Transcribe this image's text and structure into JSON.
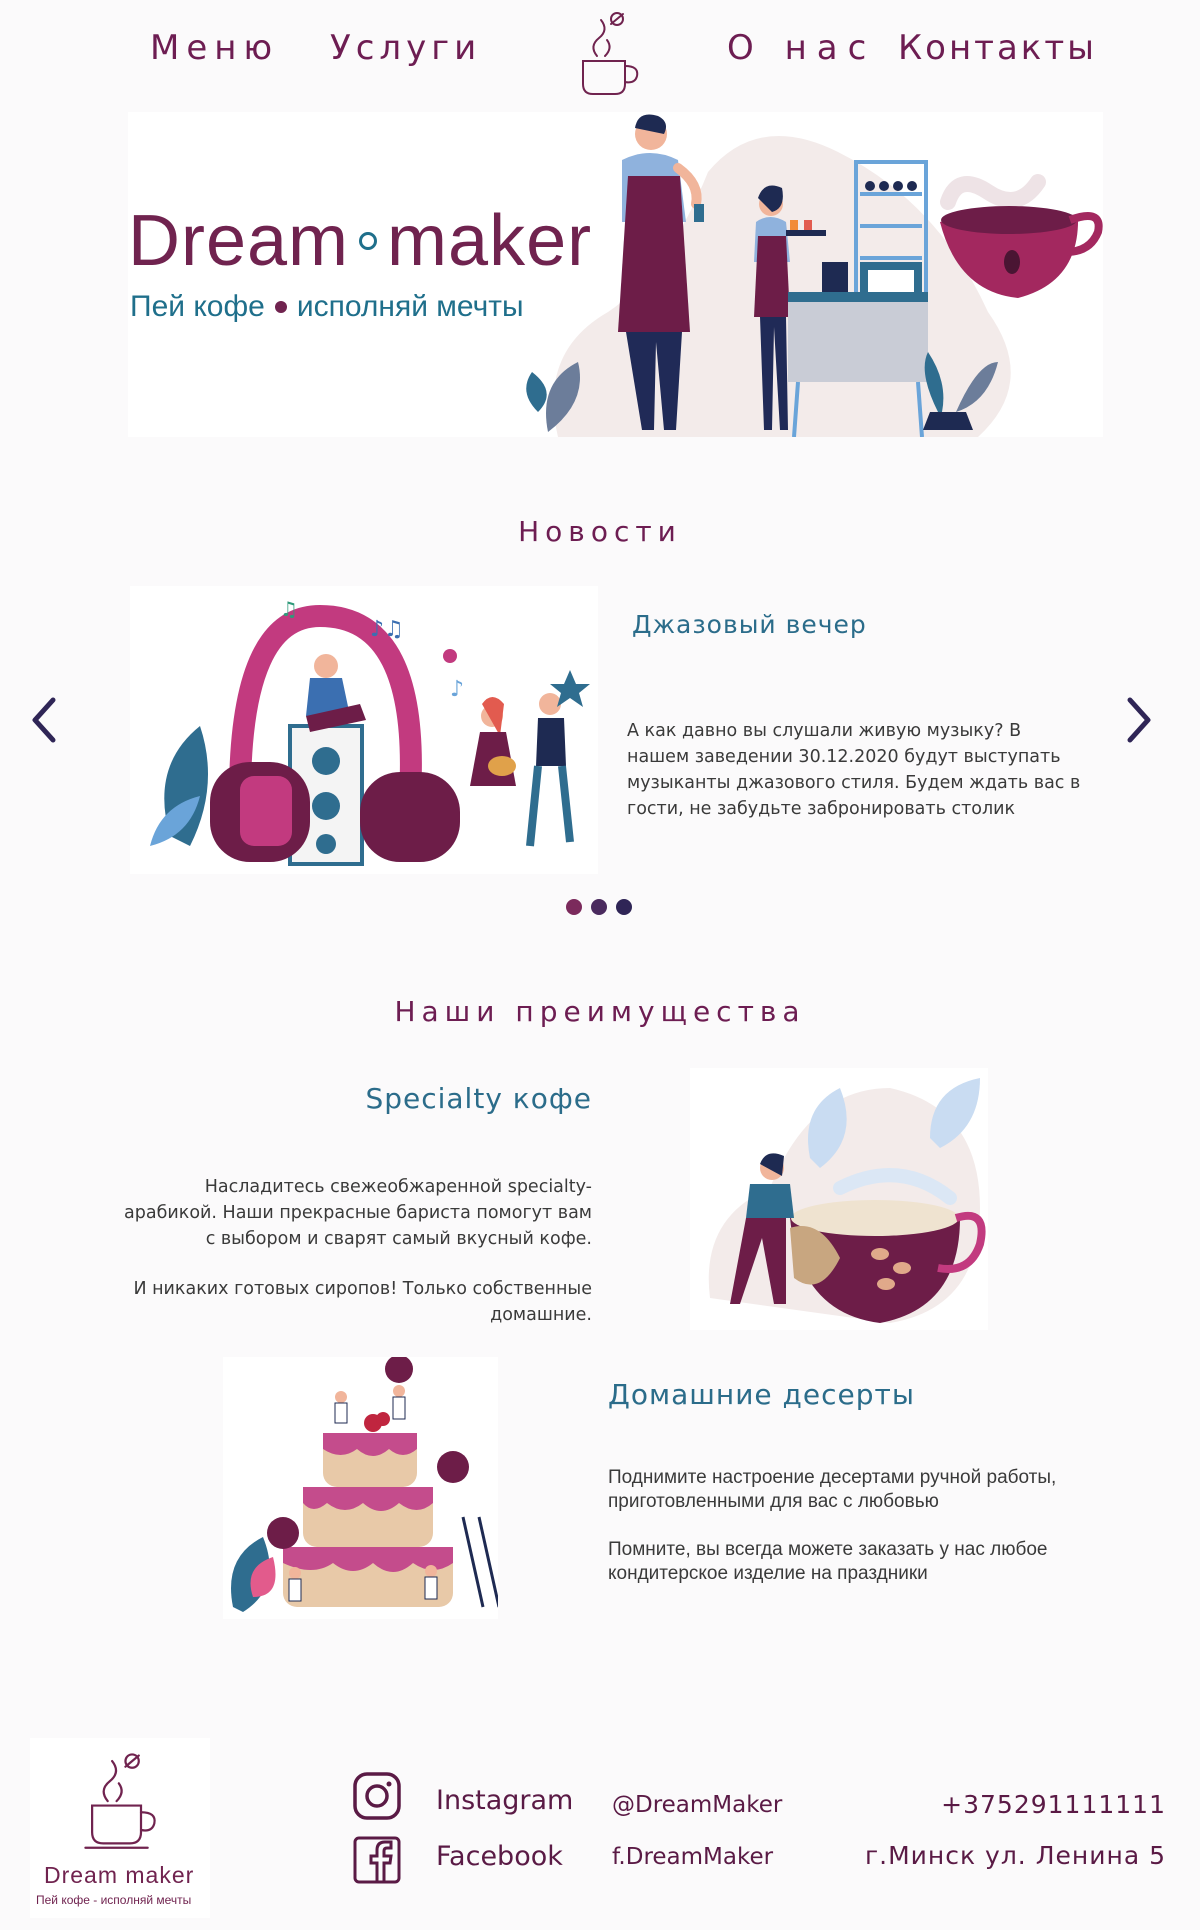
{
  "nav": {
    "items": [
      "Меню",
      "Услуги",
      "О нас",
      "Контакты"
    ]
  },
  "hero": {
    "brand_left": "Dream",
    "brand_right": "maker",
    "slogan_left": "Пей кофе",
    "slogan_right": "исполняй мечты"
  },
  "news": {
    "title": "Новости",
    "item": {
      "heading": "Джазовый вечер",
      "text": "А как давно вы слушали живую музыку? В нашем заведении 30.12.2020 будут выступать музыканты джазового стиля. Будем ждать вас в гости, не забудьте забронировать столик"
    },
    "dots": [
      {
        "color": "#7b2a5c",
        "active": true
      },
      {
        "color": "#4a2a5e",
        "active": false
      },
      {
        "color": "#2f2556",
        "active": false
      }
    ]
  },
  "advantages": {
    "title": "Наши преимущества",
    "items": [
      {
        "heading": "Specialty кофе",
        "paragraph1": "Насладитесь свежеобжаренной specialty-арабикой. Наши прекрасные бариста помогут вам с выбором и сварят самый вкусный кофе.",
        "paragraph2": "И никаких готовых сиропов! Только собственные домашние."
      },
      {
        "heading": "Домашние десерты",
        "paragraph1": "Поднимите настроение десертами ручной работы, приготовленными для вас с любовью",
        "paragraph2": "Помните, вы всегда можете заказать у нас любое кондитерское изделие на праздники"
      }
    ]
  },
  "footer": {
    "logo_name": "Dream  maker",
    "logo_slogan": "Пей кофе - исполняй мечты",
    "social": [
      {
        "name": "Instagram",
        "handle": "@DreamMaker",
        "icon": "instagram-icon"
      },
      {
        "name": "Facebook",
        "handle": "f.DreamMaker",
        "icon": "facebook-icon"
      }
    ],
    "phone": "+375291111111",
    "address": "г.Минск ул. Ленина 5"
  },
  "colors": {
    "brand": "#70234f",
    "accent": "#1f6f8b",
    "background": "#fbfafb"
  }
}
